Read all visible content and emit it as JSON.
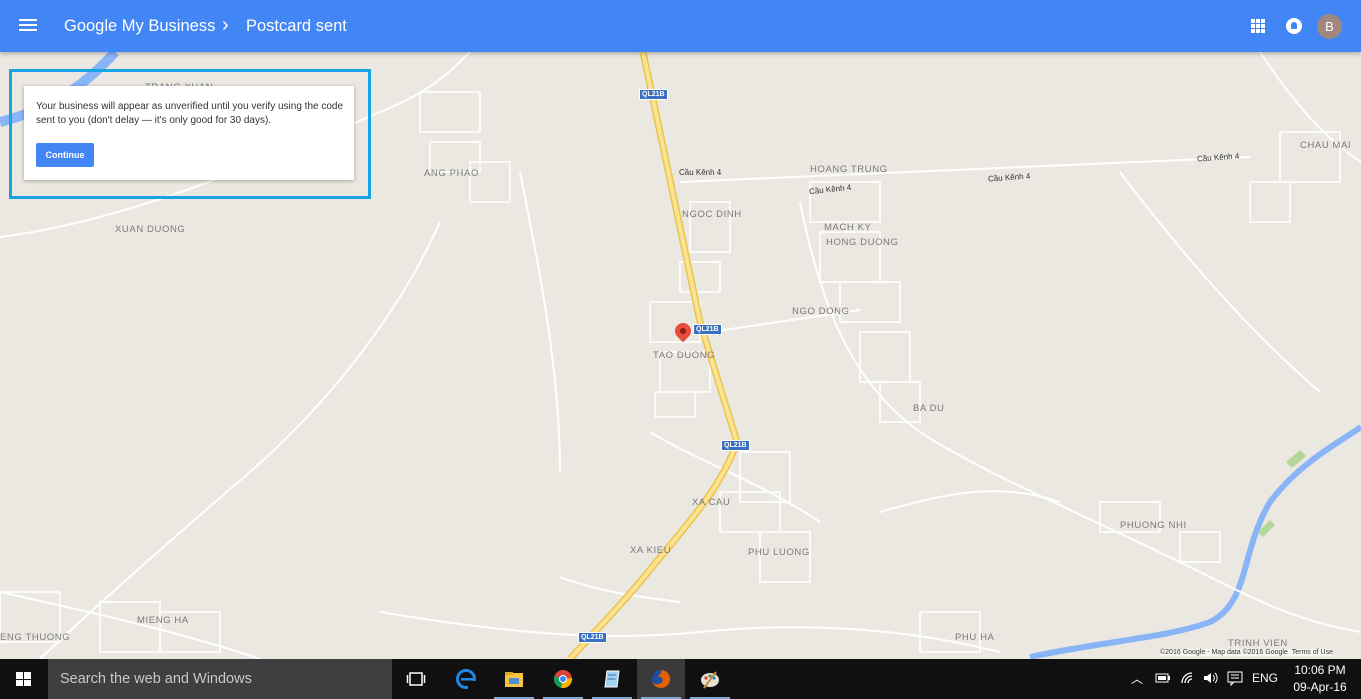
{
  "header": {
    "breadcrumb_root": "Google My Business",
    "breadcrumb_sep": "›",
    "breadcrumb_current": "Postcard sent",
    "account_initial": "B",
    "bar_color": "#4285f4"
  },
  "notice": {
    "message": "Your business will appear as unverified until you verify using the code sent to you (don't delay — it's only good for 30 days).",
    "button_label": "Continue"
  },
  "map": {
    "places": [
      "TRANG XUAN",
      "ANG PHAO",
      "XUAN DUONG",
      "HOANG TRUNG",
      "CHAU MAI",
      "NGOC DINH",
      "MACH KY",
      "HONG DUONG",
      "NGO DONG",
      "TAO DUONG",
      "BA DU",
      "XA CAU",
      "XA KIEU",
      "PHU LUONG",
      "PHUONG NHI",
      "MIENG HA",
      "ENG THUONG",
      "PHU HA",
      "TRINH VIEN"
    ],
    "roads": [
      "Cầu Kênh 4",
      "Cầu Kênh 4",
      "Cầu Kênh 4",
      "Cầu Kênh 4"
    ],
    "shields": [
      "QL21B",
      "QL21B",
      "QL21B",
      "QL21B"
    ],
    "attribution": "©2016 Google - Map data ©2016 Google",
    "terms": "Terms of Use"
  },
  "taskbar": {
    "search_placeholder": "Search the web and Windows",
    "apps": [
      "task-view",
      "edge",
      "file-explorer",
      "chrome",
      "notepad",
      "firefox",
      "paint"
    ],
    "language": "ENG",
    "time": "10:06 PM",
    "date": "09-Apr-16"
  }
}
